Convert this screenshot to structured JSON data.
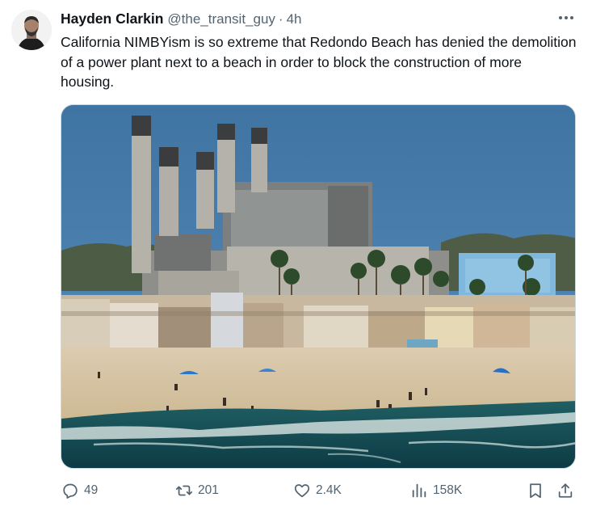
{
  "tweet": {
    "author_name": "Hayden Clarkin",
    "handle": "@the_transit_guy",
    "separator": "·",
    "time": "4h",
    "text": "California NIMBYism is so extreme that Redondo Beach has denied the demolition of a power plant next to a beach in order to block the construction of more housing.",
    "media_icon": "photo",
    "actions": {
      "replies": "49",
      "retweets": "201",
      "likes": "2.4K",
      "views": "158K"
    }
  },
  "icons": {
    "more": "more-horizontal-icon",
    "reply": "reply-icon",
    "retweet": "retweet-icon",
    "like": "heart-icon",
    "views": "views-icon",
    "bookmark": "bookmark-icon",
    "share": "share-icon"
  },
  "colors": {
    "text": "#0f1419",
    "secondary": "#536471",
    "border": "#cfd9de"
  }
}
